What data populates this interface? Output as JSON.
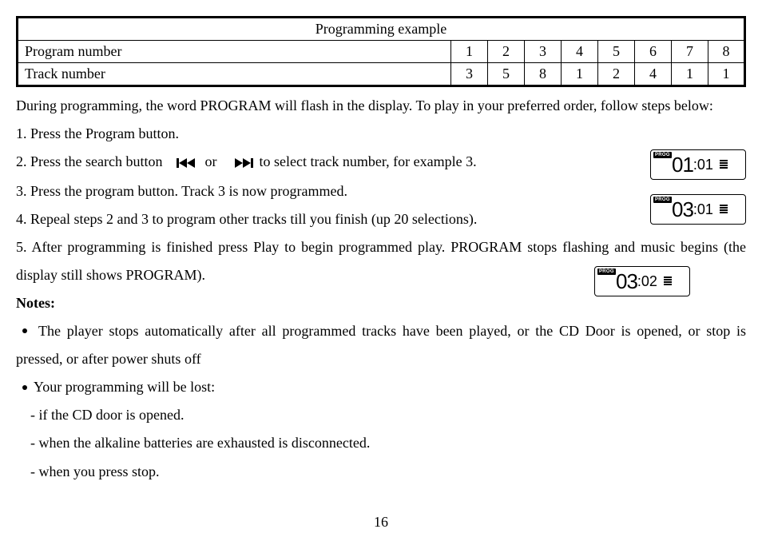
{
  "table": {
    "title": "Programming example",
    "row1_label": "Program number",
    "row1": [
      "1",
      "2",
      "3",
      "4",
      "5",
      "6",
      "7",
      "8"
    ],
    "row2_label": "Track number",
    "row2": [
      "3",
      "5",
      "8",
      "1",
      "2",
      "4",
      "1",
      "1"
    ]
  },
  "intro": "During programming, the word PROGRAM will flash in the display. To play in your preferred order, follow steps below:",
  "step1": "1. Press the Program button.",
  "step2a": "2. Press the search button",
  "step2b": "or",
  "step2c": "to select track number, for example 3.",
  "step3": "3. Press the program button.   Track 3 is now programmed.",
  "step4": "4. Repeal steps 2 and 3 to program other tracks till you finish (up 20 selections).",
  "step5": "5. After programming is finished press Play to begin programmed play. PROGRAM stops flashing and music begins (the display still shows PROGRAM).",
  "notes_label": "Notes:",
  "note1": "The player stops automatically after all programmed tracks have been played, or the CD Door is opened, or stop is pressed, or after power shuts off",
  "note2": "Your programming will be lost:",
  "note2a": "- if the CD door is opened.",
  "note2b": "- when the alkaline batteries are exhausted is disconnected.",
  "note2c": "- when you press stop.",
  "page": "16",
  "displays": {
    "d1_big": "01",
    "d1_small": ":01",
    "d2_big": "03",
    "d2_small": ":01",
    "d3_big": "03",
    "d3_small": ":02",
    "prog": "PROG"
  }
}
